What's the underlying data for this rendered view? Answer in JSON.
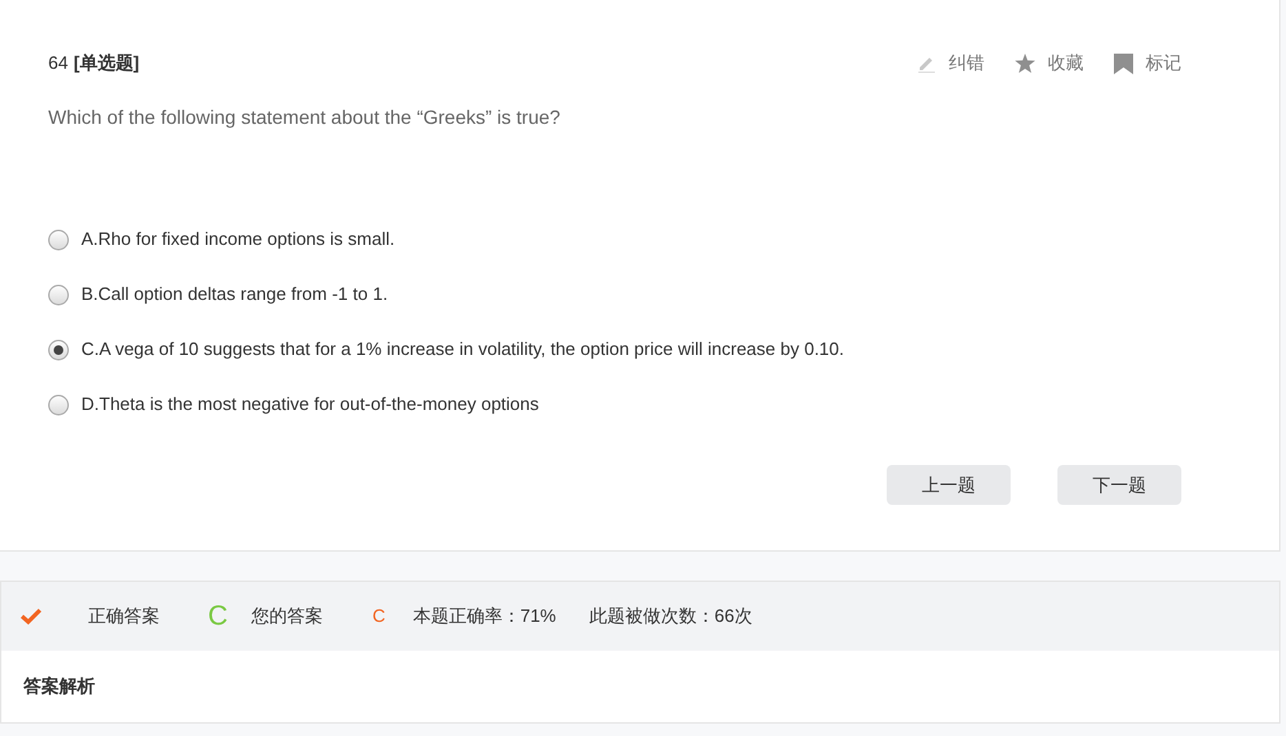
{
  "question": {
    "number": "64",
    "type": "[单选题]",
    "text": "Which of the following statement about the “Greeks” is true?"
  },
  "actions": [
    {
      "kind": "pencil",
      "label": "纠错"
    },
    {
      "kind": "star",
      "label": "收藏"
    },
    {
      "kind": "bookmark",
      "label": "标记"
    }
  ],
  "options": [
    {
      "text": "A.Rho for fixed income options is small.",
      "selected": false
    },
    {
      "text": "B.Call option deltas range from -1 to 1.",
      "selected": false
    },
    {
      "text": "C.A vega of 10 suggests that for a 1% increase in volatility, the option price will increase by 0.10.",
      "selected": true
    },
    {
      "text": "D.Theta is the most negative for out-of-the-money options",
      "selected": false
    }
  ],
  "nav_buttons": [
    "上一题",
    "下一题"
  ],
  "result": {
    "correct_label": "正确答案",
    "correct_answer": "C",
    "your_label": "您的答案",
    "your_answer": "C",
    "accuracy": "本题正确率：71%",
    "attempts": "此题被做次数：66次"
  },
  "analysis_title": "答案解析"
}
